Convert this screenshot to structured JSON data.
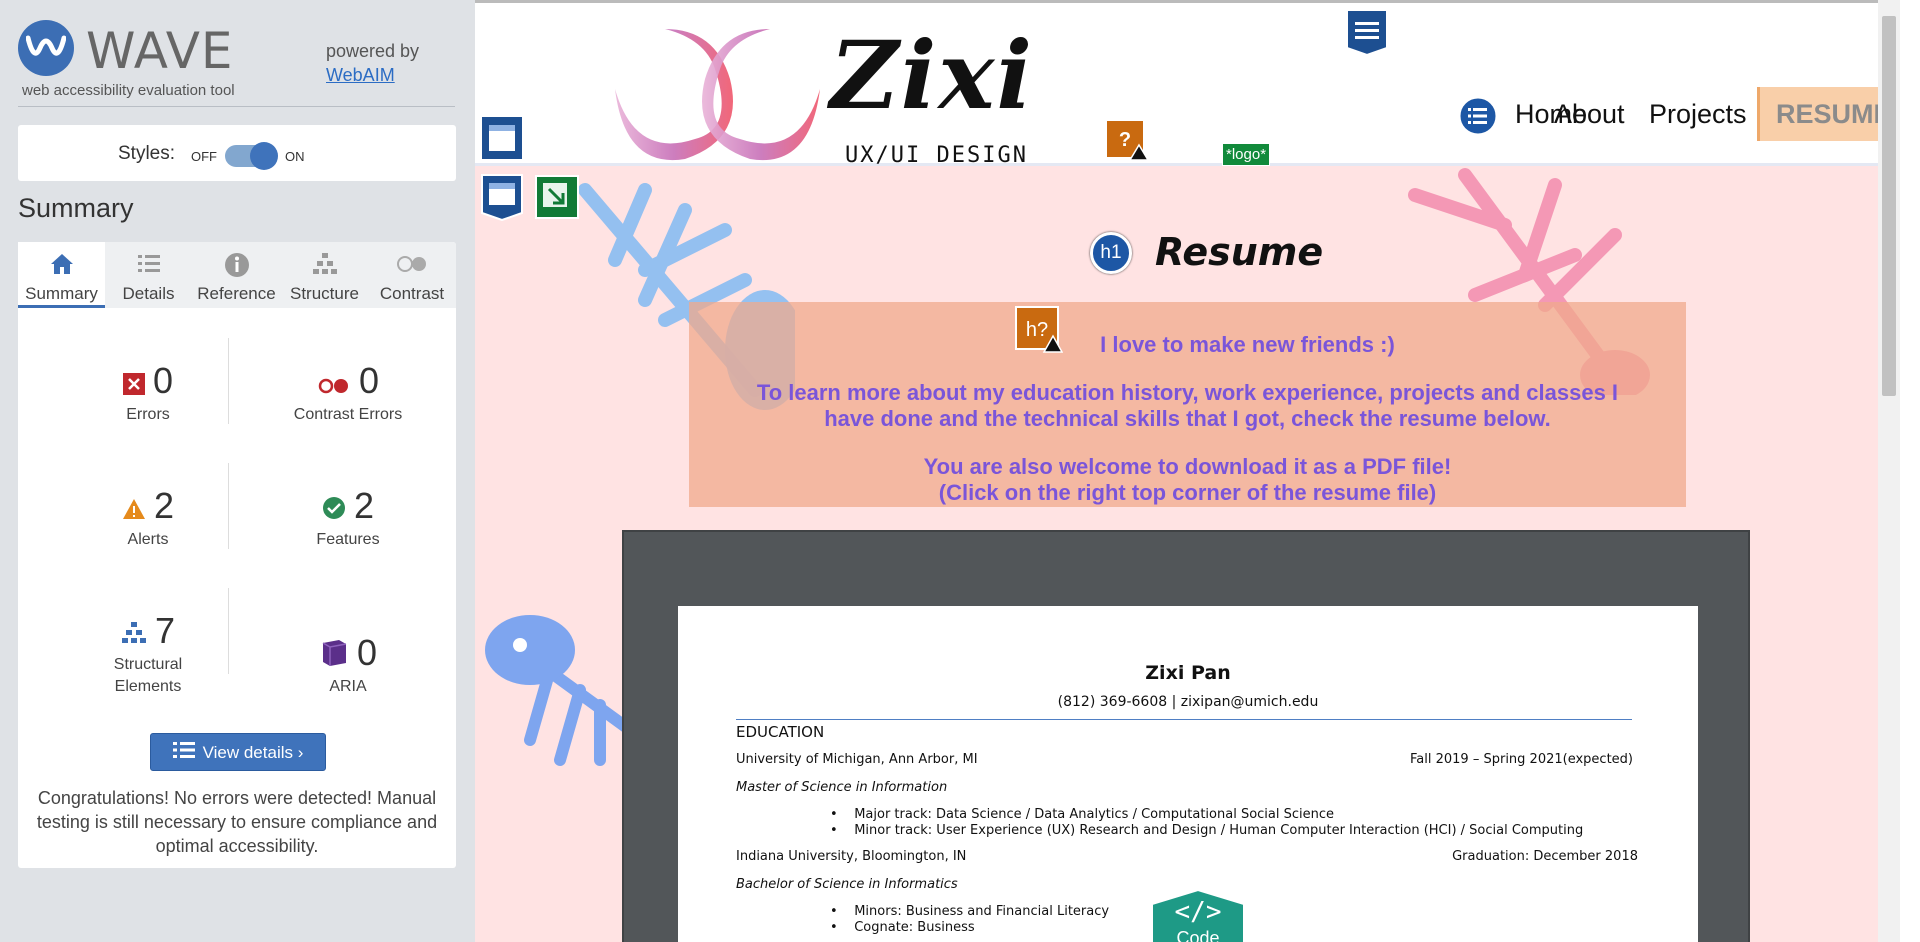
{
  "wave": {
    "title": "WAVE",
    "subtitle": "web accessibility evaluation tool",
    "powered_by": "powered by",
    "webaim_link": "WebAIM",
    "styles_label": "Styles:",
    "styles_off": "OFF",
    "styles_on": "ON",
    "summary_heading": "Summary",
    "tabs": [
      {
        "label": "Summary",
        "icon": "home-icon"
      },
      {
        "label": "Details",
        "icon": "list-icon"
      },
      {
        "label": "Reference",
        "icon": "info-icon"
      },
      {
        "label": "Structure",
        "icon": "hierarchy-icon"
      },
      {
        "label": "Contrast",
        "icon": "contrast-icon"
      }
    ],
    "stats": {
      "errors": {
        "value": "0",
        "label": "Errors"
      },
      "contrast_errors": {
        "value": "0",
        "label": "Contrast Errors"
      },
      "alerts": {
        "value": "2",
        "label": "Alerts"
      },
      "features": {
        "value": "2",
        "label": "Features"
      },
      "structural": {
        "value": "7",
        "label": "Structural Elements"
      },
      "aria": {
        "value": "0",
        "label": "ARIA"
      }
    },
    "view_details": "View details ›",
    "congrats": "Congratulations! No errors were detected! Manual testing is still necessary to ensure compliance and optimal accessibility."
  },
  "site": {
    "brand": "Zixi",
    "brand_sub": "UX/UI DESIGN",
    "logo_alt_badge": "*logo*",
    "nav": [
      "Home",
      "About",
      "Projects",
      "RESUME"
    ],
    "h1_badge": "h1",
    "heading": "Resume",
    "h_badge": "h?",
    "intro_line1": "I love to make new friends :)",
    "intro_line2": "To learn more about my education history, work experience, projects and classes I",
    "intro_line3": "have done and the technical skills that I got, check the resume below.",
    "intro_line4": "You are also welcome to download it as a PDF file!",
    "intro_line5": "(Click on the right top corner of the resume file)",
    "code_badge": "Code"
  },
  "resume": {
    "name": "Zixi Pan",
    "contact": "(812) 369-6608 | zixipan@umich.edu",
    "section_education": "EDUCATION",
    "school1": "University of Michigan, Ann Arbor, MI",
    "school1_date": "Fall 2019 – Spring 2021(expected)",
    "degree1": "Master of Science in Information",
    "bullet1": "Major track: Data Science / Data Analytics / Computational Social Science",
    "bullet2": "Minor track: User Experience (UX) Research and Design / Human Computer Interaction (HCI) / Social Computing",
    "school2": "Indiana University, Bloomington, IN",
    "school2_date": "Graduation: December 2018",
    "degree2": "Bachelor of Science in Informatics",
    "bullet3": "Minors: Business and Financial Literacy",
    "bullet4": "Cognate: Business"
  },
  "colors": {
    "wave_blue": "#3c6eb4",
    "error_red": "#c0282d",
    "alert_orange": "#e58a1c",
    "feature_green": "#2e8b57",
    "intro_text": "#7a55d9",
    "resume_nav_bg": "#f9cfa9"
  }
}
